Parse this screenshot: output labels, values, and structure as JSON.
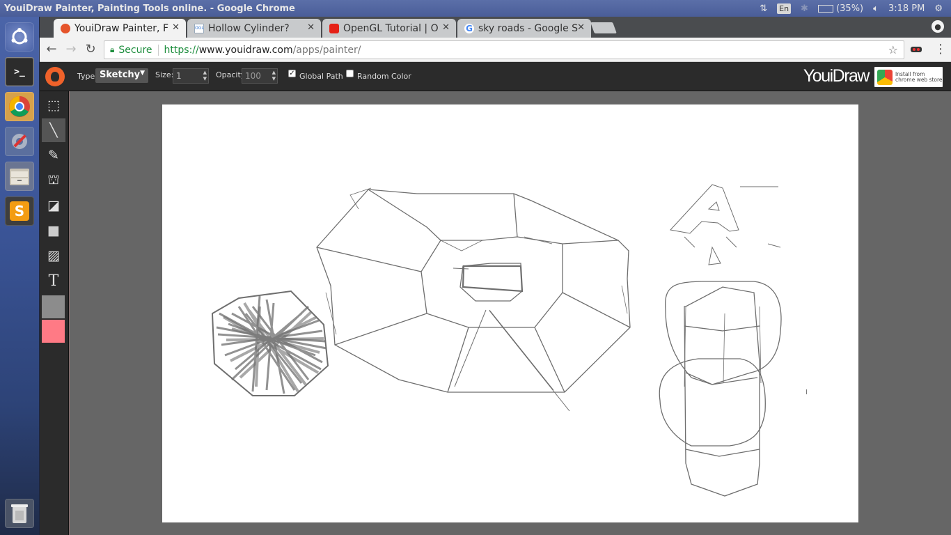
{
  "window": {
    "title": "YouiDraw Painter, Painting Tools online. - Google Chrome"
  },
  "system_tray": {
    "input_language": "En",
    "battery_level": "(35%)",
    "clock": "3:18 PM"
  },
  "launcher": {
    "items": [
      {
        "name": "dash-icon"
      },
      {
        "name": "terminal-icon",
        "glyph": ">_"
      },
      {
        "name": "chrome-icon"
      },
      {
        "name": "system-settings-icon"
      },
      {
        "name": "files-icon"
      },
      {
        "name": "sublime-text-icon",
        "glyph": "S"
      },
      {
        "name": "trash-icon"
      }
    ]
  },
  "browser": {
    "tabs": [
      {
        "label": "YouiDraw Painter, F",
        "active": true,
        "icon_color": "#e5542b"
      },
      {
        "label": "Hollow Cylinder?",
        "active": false,
        "icon_color": "#3a7bd5",
        "icon_text": "OGL"
      },
      {
        "label": "OpenGL Tutorial | O",
        "active": false,
        "icon_color": "#e62117"
      },
      {
        "label": "sky roads - Google S",
        "active": false,
        "icon_color": "#4285f4",
        "icon_text": "G"
      }
    ],
    "url": {
      "secure_label": "Secure",
      "scheme": "https://",
      "host": "www.youidraw.com",
      "path": "/apps/painter/"
    }
  },
  "app_toolbar": {
    "type_label": "Type:",
    "type_value": "Sketchy",
    "size_label": "Size:",
    "size_value": "1",
    "opacity_label": "Opacity:",
    "opacity_value": "100",
    "global_path_label": "Global Path",
    "global_path_checked": true,
    "random_color_label": "Random Color",
    "random_color_checked": false,
    "brand": "YouiDraw",
    "store_badge": {
      "line1": "Install from",
      "line2": "chrome web store"
    }
  },
  "tools": [
    {
      "name": "select-tool-icon",
      "glyph": "⬚",
      "selected": false
    },
    {
      "name": "pencil-tool-icon",
      "glyph": "╲",
      "selected": true
    },
    {
      "name": "brush-tool-icon",
      "glyph": "✎",
      "selected": false
    },
    {
      "name": "fill-bucket-tool-icon",
      "glyph": "⛫",
      "selected": false
    },
    {
      "name": "eraser-tool-icon",
      "glyph": "◪",
      "selected": false
    },
    {
      "name": "shape-tool-icon",
      "glyph": "■",
      "selected": false
    },
    {
      "name": "image-tool-icon",
      "glyph": "▨",
      "selected": false
    },
    {
      "name": "text-tool-icon",
      "glyph": "T",
      "selected": false
    }
  ],
  "colors": {
    "primary": "#8c8c8c",
    "secondary": "#ff7a85",
    "stroke": "#6e6e6e"
  },
  "canvas": {
    "cursor_text": "I"
  }
}
